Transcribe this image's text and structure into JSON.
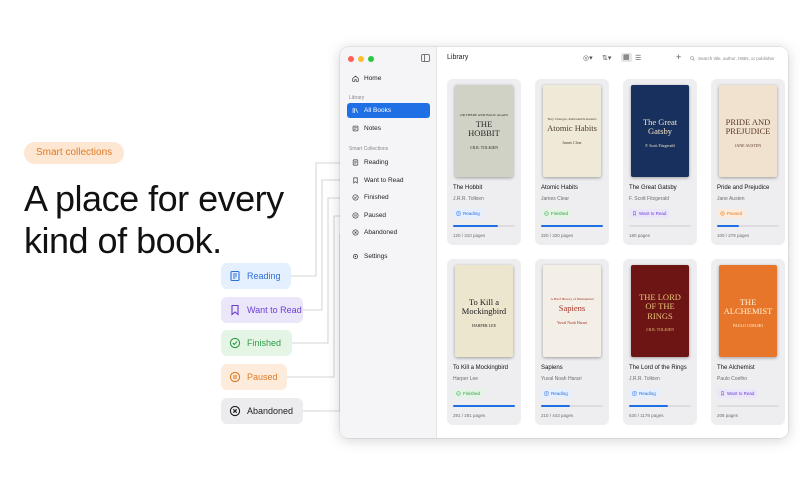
{
  "marketing": {
    "tag": "Smart collections",
    "headline": "A place for every\nkind of book."
  },
  "chips": [
    {
      "label": "Reading",
      "icon": "book-icon",
      "bg": "#e4efff",
      "fg": "#2f6fdc"
    },
    {
      "label": "Want to Read",
      "icon": "bookmark-icon",
      "bg": "#ece6fb",
      "fg": "#6a3fd0"
    },
    {
      "label": "Finished",
      "icon": "check-circle-icon",
      "bg": "#e4f5e6",
      "fg": "#2f9a45"
    },
    {
      "label": "Paused",
      "icon": "pause-circle-icon",
      "bg": "#fdecdc",
      "fg": "#e07a24"
    },
    {
      "label": "Abandoned",
      "icon": "x-circle-icon",
      "bg": "#ececee",
      "fg": "#1d1d1f"
    }
  ],
  "sidebar": {
    "home": "Home",
    "library_section": "Library",
    "all_books": "All Books",
    "notes": "Notes",
    "smart_section": "Smart Collections",
    "collections": [
      "Reading",
      "Want to Read",
      "Finished",
      "Paused",
      "Abandoned"
    ],
    "settings": "Settings"
  },
  "toolbar": {
    "title": "Library",
    "search_placeholder": "Search title, author, ISBN, or publisher"
  },
  "books": [
    {
      "title": "The Hobbit",
      "author": "J.R.R. Tolkien",
      "status": "Reading",
      "progress": 0.73,
      "pages": "120 / 310 pages",
      "cover_title": "THE HOBBIT",
      "cover_sub": "OR THERE AND BACK AGAIN",
      "cover_author": "J.R.R. TOLKIEN",
      "cover_bg": "#cfd2c4"
    },
    {
      "title": "Atomic Habits",
      "author": "James Clear",
      "status": "Finished",
      "progress": 1.0,
      "pages": "320 / 320 pages",
      "cover_title": "Atomic Habits",
      "cover_sub": "Tiny Changes, Remarkable Results",
      "cover_author": "James Clear",
      "cover_bg": "#efe9d8"
    },
    {
      "title": "The Great Gatsby",
      "author": "F. Scott Fitzgerald",
      "status": "Want to Read",
      "progress": 0,
      "pages": "180 pages",
      "cover_title": "The Great Gatsby",
      "cover_sub": "",
      "cover_author": "F. Scott Fitzgerald",
      "cover_bg": "#17305e"
    },
    {
      "title": "Pride and Prejudice",
      "author": "Jane Austen",
      "status": "Paused",
      "progress": 0.35,
      "pages": "100 / 279 pages",
      "cover_title": "PRIDE AND PREJUDICE",
      "cover_sub": "",
      "cover_author": "JANE AUSTEN",
      "cover_bg": "#f1e2cf"
    },
    {
      "title": "To Kill a Mockingbird",
      "author": "Harper Lee",
      "status": "Finished",
      "progress": 1.0,
      "pages": "281 / 281 pages",
      "cover_title": "To Kill a Mockingbird",
      "cover_sub": "",
      "cover_author": "HARPER LEE",
      "cover_bg": "#ece6cf"
    },
    {
      "title": "Sapiens",
      "author": "Yuval Noah Harari",
      "status": "Reading",
      "progress": 0.47,
      "pages": "210 / 443 pages",
      "cover_title": "Sapiens",
      "cover_sub": "A Brief History of Humankind",
      "cover_author": "Yuval Noah Harari",
      "cover_bg": "#f3efe6"
    },
    {
      "title": "The Lord of the Rings",
      "author": "J.R.R. Tolkien",
      "status": "Reading",
      "progress": 0.63,
      "pages": "630 / 1178 pages",
      "cover_title": "THE LORD OF THE RINGS",
      "cover_sub": "",
      "cover_author": "J.R.R. TOLKIEN",
      "cover_bg": "#6d1414"
    },
    {
      "title": "The Alchemist",
      "author": "Paulo Coelho",
      "status": "Want to Read",
      "progress": 0,
      "pages": "208 pages",
      "cover_title": "THE ALCHEMIST",
      "cover_sub": "",
      "cover_author": "PAULO COELHO",
      "cover_bg": "#e8762a"
    }
  ],
  "colors": {
    "accent": "#1f6fe5",
    "reading": "#2f6fdc",
    "want": "#6a3fd0",
    "finished": "#2f9a45",
    "paused": "#e07a24"
  }
}
